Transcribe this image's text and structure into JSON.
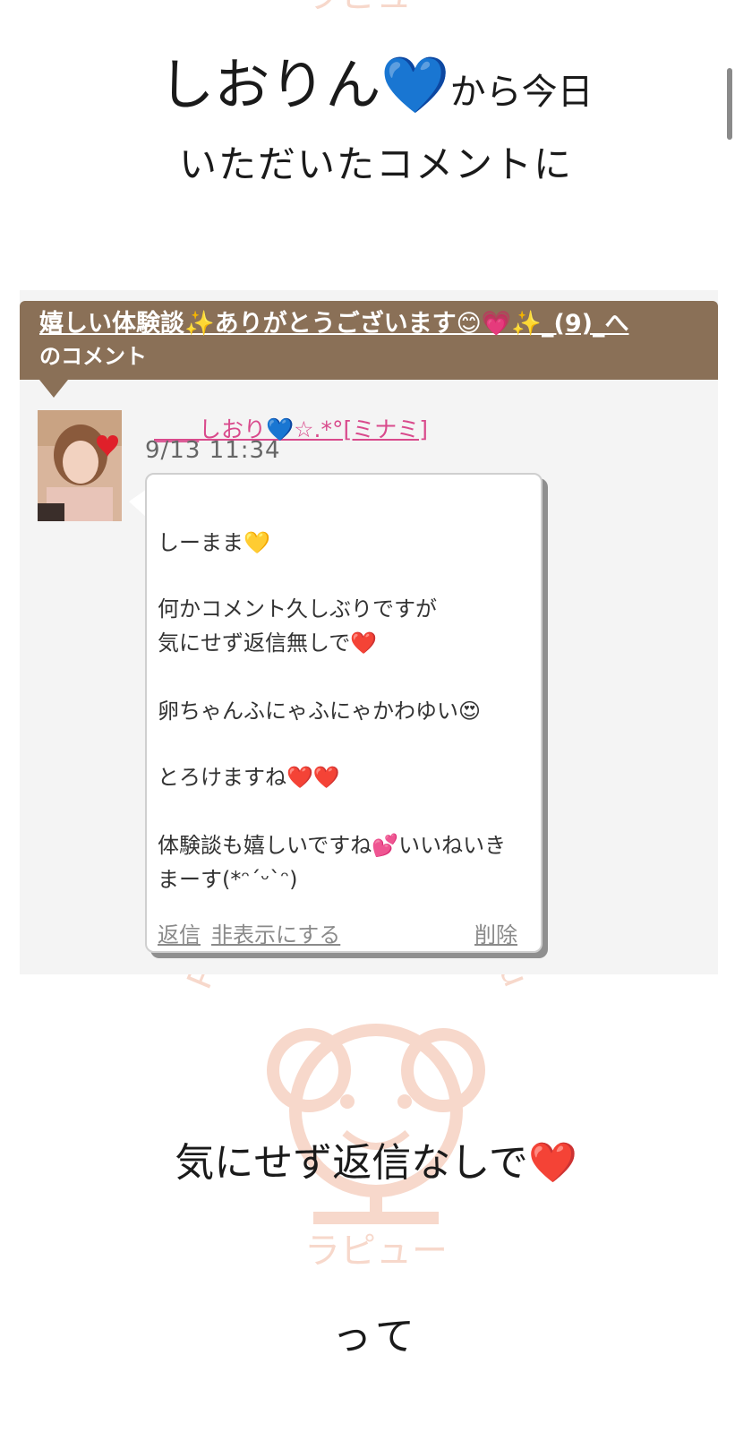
{
  "headline": {
    "name": "しおりん",
    "name_emoji": "💙",
    "suffix": "から今日",
    "line2": "いただいたコメントに",
    "line3": "気にせず返信なしで",
    "line3_emoji": "❤️",
    "line4": "って"
  },
  "watermark": {
    "top_text": "ラピュー",
    "circle_text": "Public House Rapyou",
    "bottom_text": "ラピュー",
    "color": "#f5c9b6"
  },
  "post": {
    "title": "嬉しい体験談✨ありがとうございます😊💗✨_(9)_へ",
    "title_line2": "のコメント",
    "header_color": "#8a7057"
  },
  "comment": {
    "username": "____しおり💙☆.*°[ミナミ]",
    "date": "9/13 11:34",
    "avatar_icon": "heart-icon",
    "lines": [
      "しーまま💛",
      "何かコメント久しぶりですが",
      "気にせず返信無しで❤️",
      "卵ちゃんふにゃふにゃかわゆい😍",
      "とろけますね❤️❤️",
      "体験談も嬉しいですね💕いいねいき",
      "まーす(*ᵔ´ᵕ`ᵔ)"
    ],
    "actions": {
      "reply": "返信",
      "hide": "非表示にする",
      "delete": "削除"
    }
  }
}
